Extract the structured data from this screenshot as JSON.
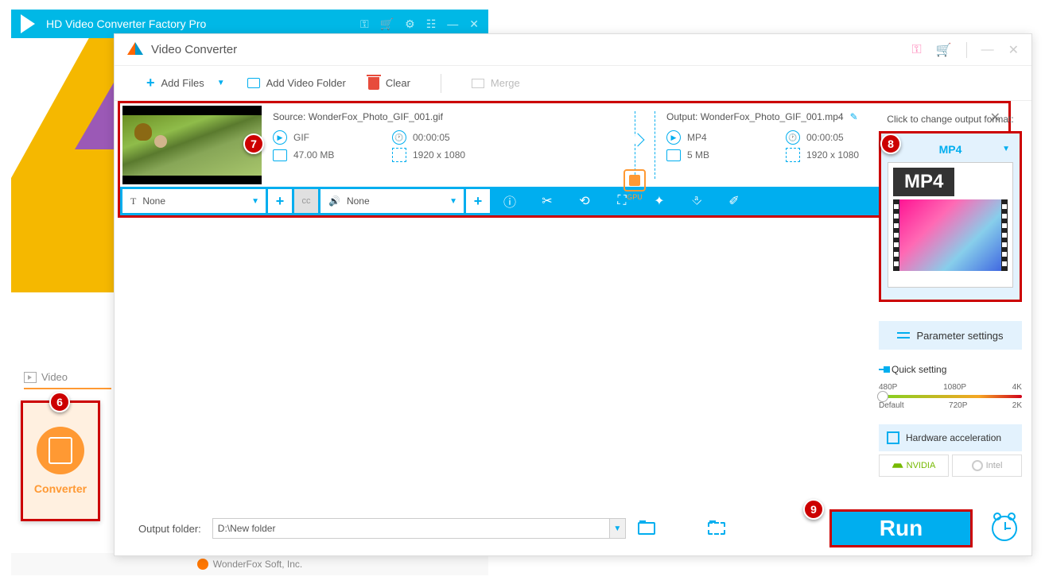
{
  "bg_app": {
    "title": "HD Video Converter Factory Pro"
  },
  "footer": "WonderFox Soft, Inc.",
  "video_section": "Video",
  "converter_tile": "Converter",
  "main_title": "Video Converter",
  "toolbar": {
    "add_files": "Add Files",
    "add_folder": "Add Video Folder",
    "clear": "Clear",
    "merge": "Merge"
  },
  "item": {
    "source_label": "Source: WonderFox_Photo_GIF_001.gif",
    "output_label": "Output: WonderFox_Photo_GIF_001.mp4",
    "src": {
      "format": "GIF",
      "duration": "00:00:05",
      "size": "47.00 MB",
      "res": "1920 x 1080"
    },
    "out": {
      "format": "MP4",
      "duration": "00:00:05",
      "size": "5 MB",
      "res": "1920 x 1080"
    },
    "gpu": "GPU",
    "subtitle": "None",
    "audio": "None"
  },
  "right": {
    "format_hint": "Click to change output format:",
    "format": "MP4",
    "format_badge": "MP4",
    "param": "Parameter settings",
    "quick": "Quick setting",
    "res": {
      "p480": "480P",
      "p720": "720P",
      "p1080": "1080P",
      "p2k": "2K",
      "p4k": "4K",
      "default": "Default"
    },
    "hw": "Hardware acceleration",
    "nvidia": "NVIDIA",
    "intel": "Intel"
  },
  "bottom": {
    "label": "Output folder:",
    "path": "D:\\New folder",
    "run": "Run"
  },
  "callouts": {
    "c6": "6",
    "c7": "7",
    "c8": "8",
    "c9": "9"
  }
}
